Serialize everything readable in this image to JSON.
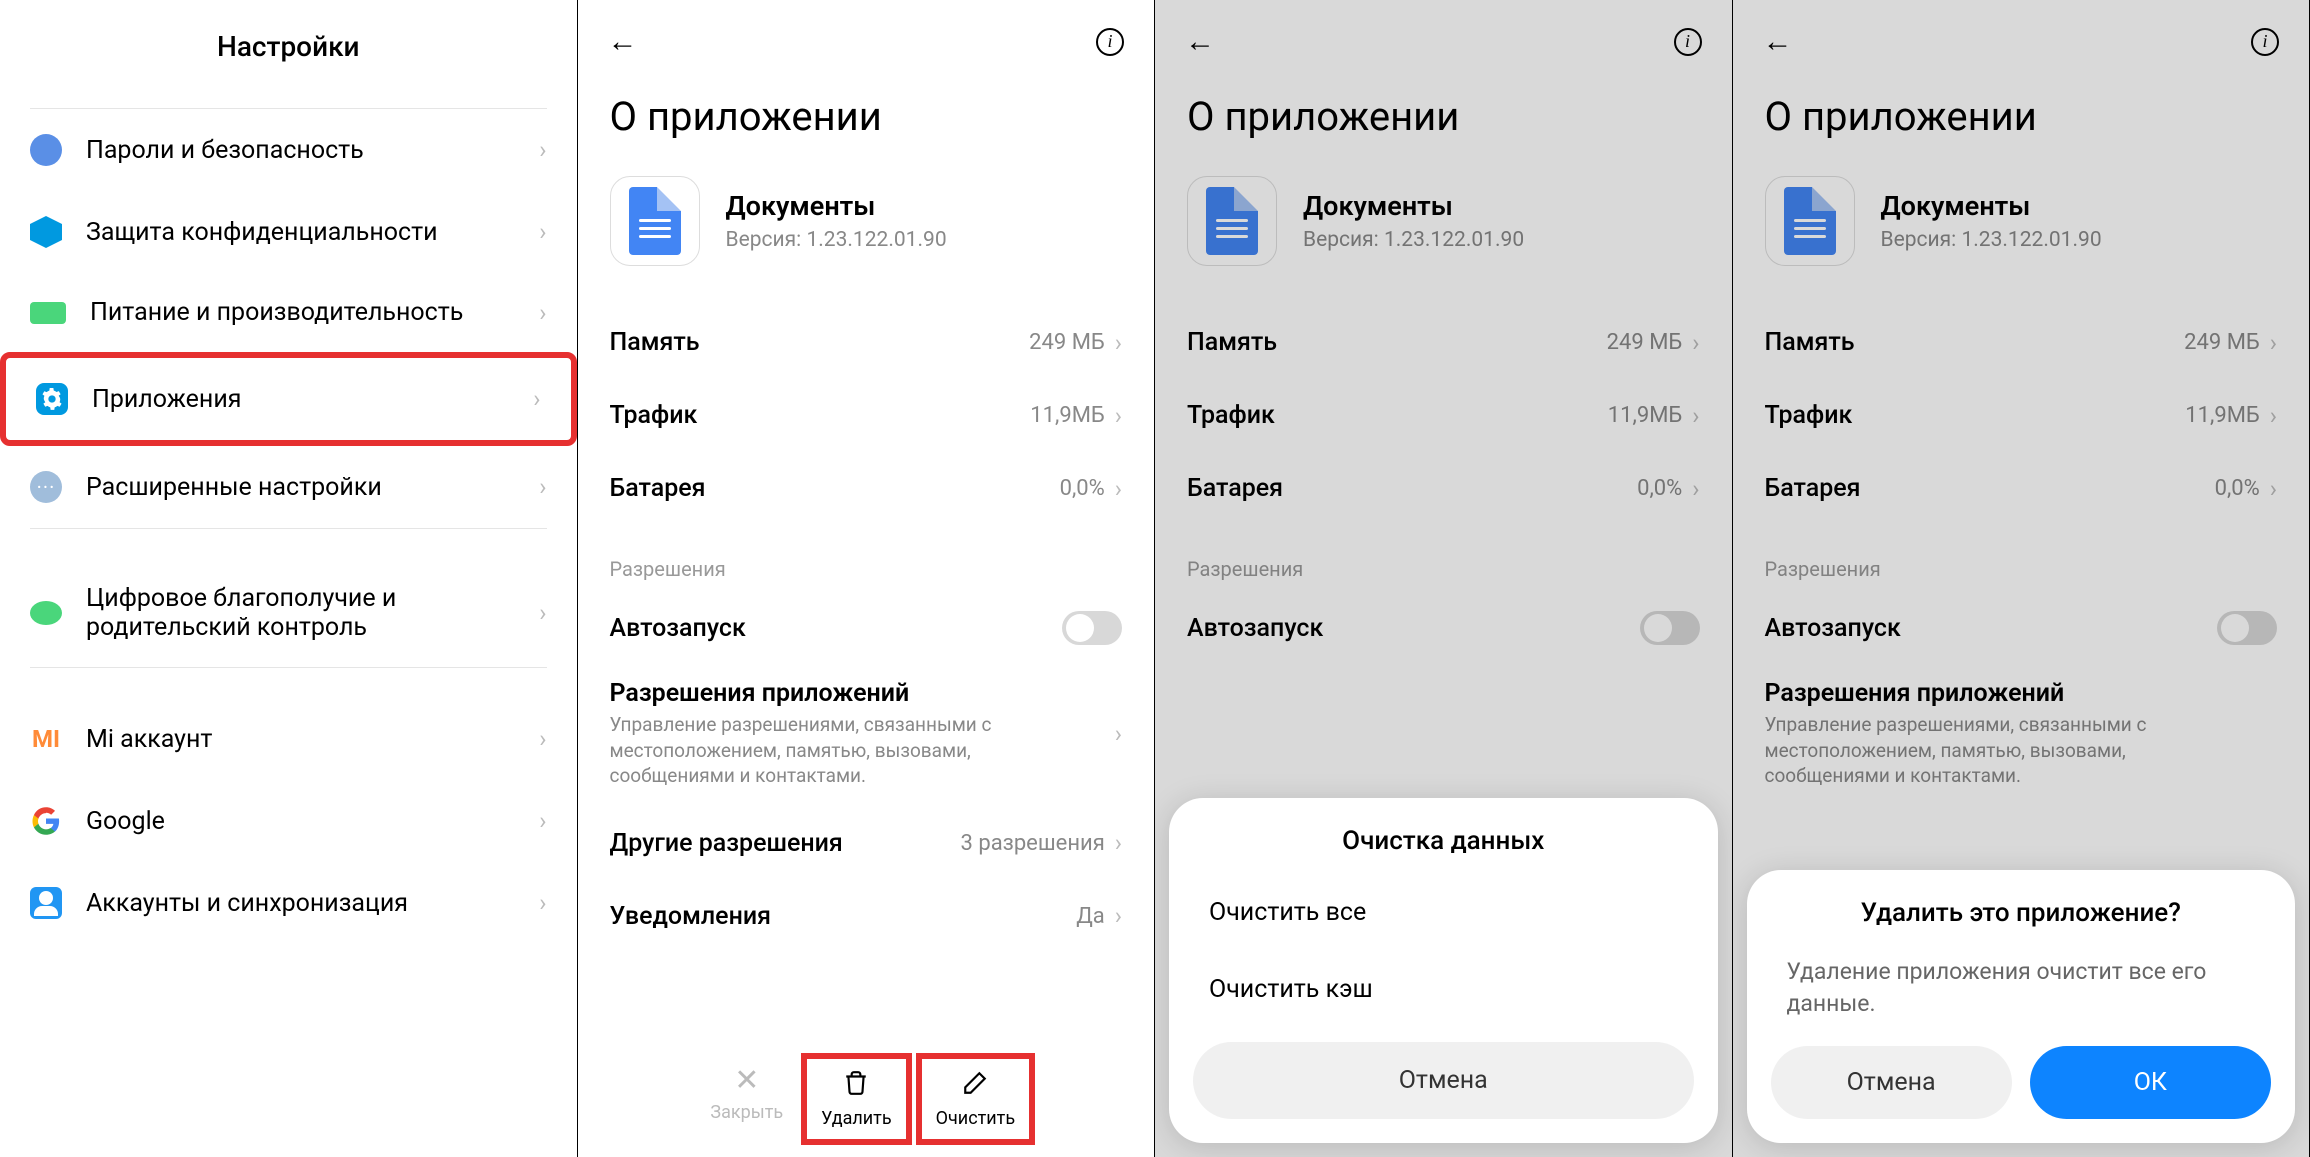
{
  "screen1": {
    "title": "Настройки",
    "items": [
      {
        "label": "Пароли и безопасность"
      },
      {
        "label": "Защита конфиденциальности"
      },
      {
        "label": "Питание и производительность"
      },
      {
        "label": "Приложения"
      },
      {
        "label": "Расширенные настройки"
      },
      {
        "label": "Цифровое благополучие и родительский контроль"
      },
      {
        "label": "Mi аккаунт"
      },
      {
        "label": "Google"
      },
      {
        "label": "Аккаунты и синхронизация"
      }
    ]
  },
  "appInfo": {
    "page_title": "О приложении",
    "app_name": "Документы",
    "version_label": "Версия: 1.23.122.01.90",
    "rows": {
      "memory_label": "Память",
      "memory_value": "249 МБ",
      "traffic_label": "Трафик",
      "traffic_value": "11,9МБ",
      "battery_label": "Батарея",
      "battery_value": "0,0%"
    },
    "permissions_section": "Разрешения",
    "autostart_label": "Автозапуск",
    "perm_title": "Разрешения приложений",
    "perm_desc": "Управление разрешениями, связанными с местоположением, памятью, вызовами, сообщениями и контактами.",
    "other_perm_label": "Другие разрешения",
    "other_perm_value": "3 разрешения",
    "notifications_label": "Уведомления",
    "notifications_value": "Да",
    "buttons": {
      "close": "Закрыть",
      "delete": "Удалить",
      "clear": "Очистить"
    }
  },
  "clearDialog": {
    "title": "Очистка данных",
    "option_all": "Очистить все",
    "option_cache": "Очистить кэш",
    "cancel": "Отмена"
  },
  "deleteDialog": {
    "title": "Удалить это приложение?",
    "message": "Удаление приложения очистит все его данные.",
    "cancel": "Отмена",
    "ok": "ОК"
  }
}
